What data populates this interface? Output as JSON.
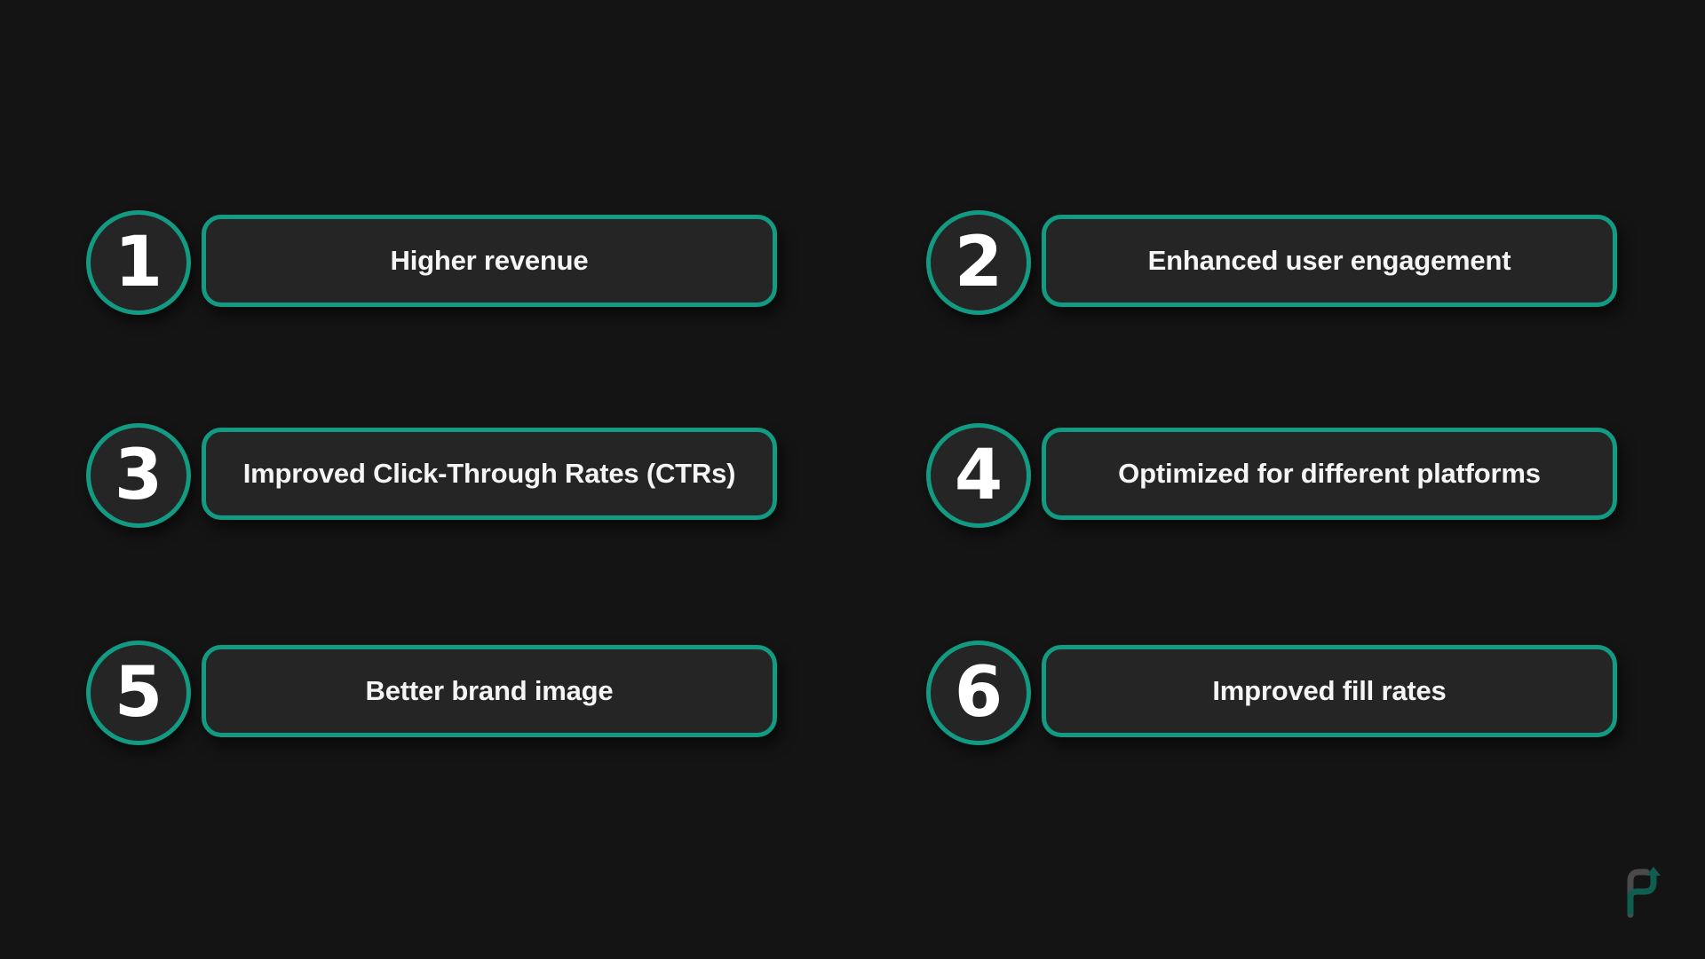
{
  "items": [
    {
      "number": "1",
      "label": "Higher revenue"
    },
    {
      "number": "2",
      "label": "Enhanced user engagement"
    },
    {
      "number": "3",
      "label": "Improved Click-Through Rates (CTRs)"
    },
    {
      "number": "4",
      "label": "Optimized for different platforms"
    },
    {
      "number": "5",
      "label": "Better brand image"
    },
    {
      "number": "6",
      "label": "Improved fill rates"
    }
  ],
  "colors": {
    "background": "#141414",
    "card": "#252525",
    "accent": "#139a82",
    "text": "#ffffff"
  },
  "logo": {
    "icon": "brand-logo-arrow-icon"
  }
}
